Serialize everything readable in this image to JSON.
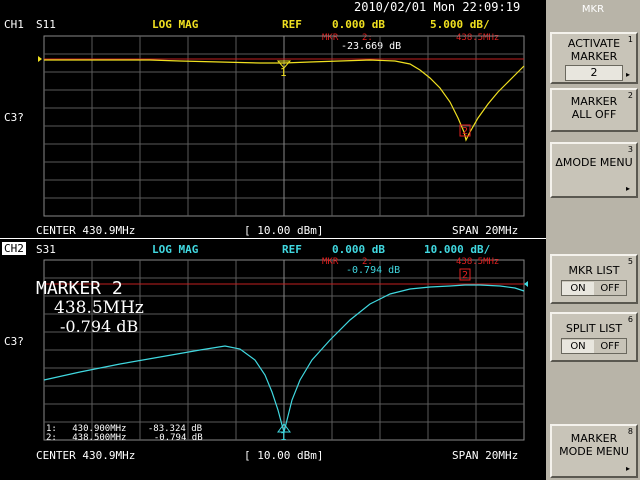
{
  "datetime": "2010/02/01 Mon 22:09:19",
  "softkeys": {
    "title": "MKR",
    "activate_marker": {
      "num": "1",
      "line1": "ACTIVATE",
      "line2": "MARKER",
      "value": "2"
    },
    "marker_all_off": {
      "num": "2",
      "line1": "MARKER",
      "line2": "ALL OFF"
    },
    "delta_mode": {
      "num": "3",
      "line1": "ΔMODE MENU"
    },
    "mkr_list": {
      "num": "5",
      "line1": "MKR LIST",
      "on": "ON",
      "off": "OFF",
      "state": "ON"
    },
    "split_list": {
      "num": "6",
      "line1": "SPLIT LIST",
      "on": "ON",
      "off": "OFF",
      "state": "ON"
    },
    "marker_mode": {
      "num": "8",
      "line1": "MARKER",
      "line2": "MODE MENU"
    }
  },
  "ch1": {
    "channel": "CH1",
    "param": "S11",
    "format": "LOG MAG",
    "ref_label": "REF",
    "ref_value": "0.000 dB",
    "scale": "5.000 dB/",
    "mkr_label": "MKR",
    "mkr_num": "2:",
    "mkr_freq": "438.5MHz",
    "mkr_value": "-23.669 dB",
    "side_label": "C3?",
    "center": "CENTER 430.9MHz",
    "power": "[ 10.00 dBm]",
    "span": "SPAN 20MHz",
    "marker1_label": "1",
    "marker2_label": "2",
    "color": "#f0e020"
  },
  "ch2": {
    "channel": "CH2",
    "param": "S31",
    "format": "LOG MAG",
    "ref_label": "REF",
    "ref_value": "0.000 dB",
    "scale": "10.000 dB/",
    "mkr_label": "MKR",
    "mkr_num": "2:",
    "mkr_freq": "438.5MHz",
    "mkr_value": "-0.794 dB",
    "side_label": "C3?",
    "center": "CENTER 430.9MHz",
    "power": "[ 10.00 dBm]",
    "span": "SPAN 20MHz",
    "marker1_label": "1",
    "marker2_label": "2",
    "color": "#40d8e0",
    "big_marker": {
      "title": "MARKER 2",
      "freq": "438.5MHz",
      "value": "-0.794 dB"
    },
    "marker_list": [
      {
        "idx": "1:",
        "freq": "430.900MHz",
        "value": "-83.324 dB"
      },
      {
        "idx": "2:",
        "freq": "438.500MHz",
        "value": "-0.794 dB"
      }
    ]
  }
}
